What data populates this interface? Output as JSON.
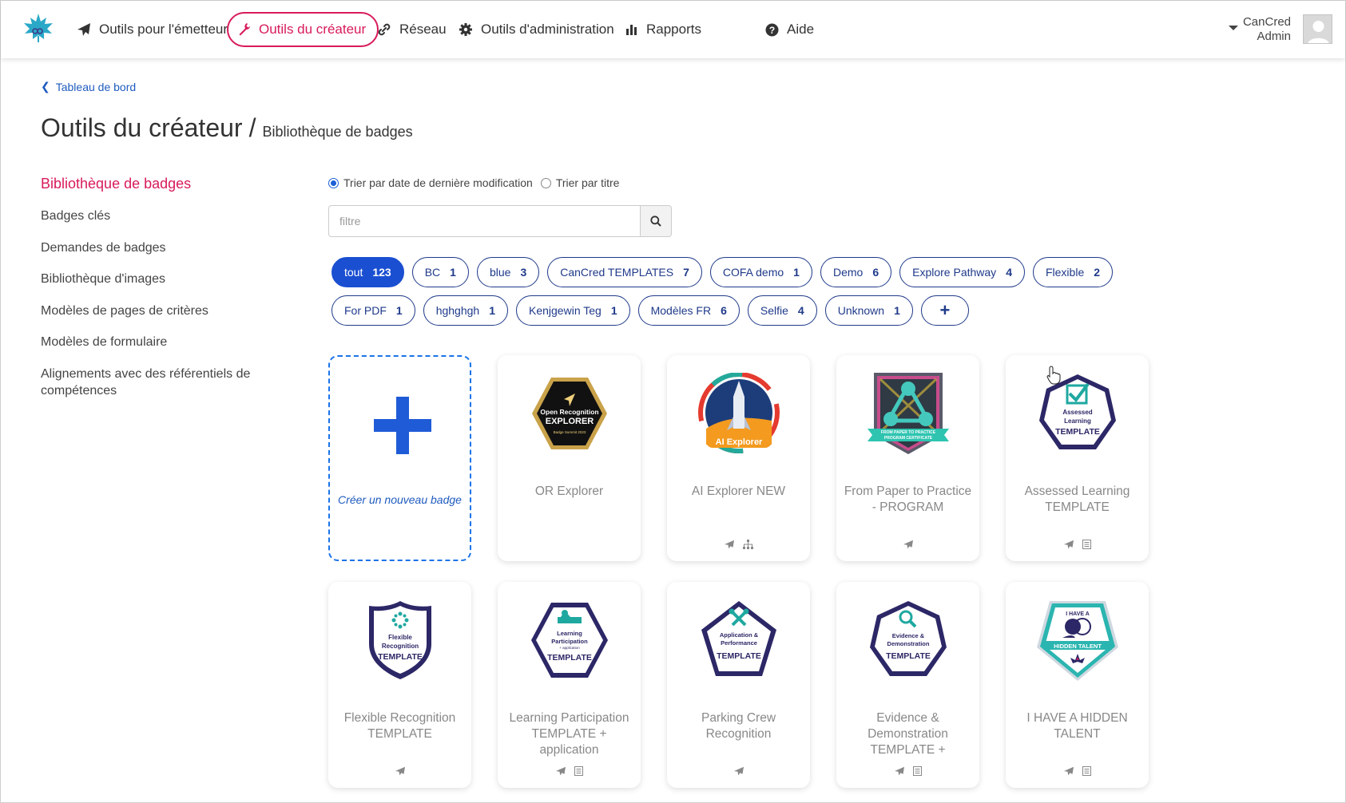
{
  "nav": {
    "items": [
      {
        "label": "Outils pour l'émetteur",
        "icon": "paper-plane-icon"
      },
      {
        "label": "Outils du créateur",
        "icon": "wrench-icon"
      },
      {
        "label": "Réseau",
        "icon": "link-icon"
      },
      {
        "label": "Outils d'administration",
        "icon": "gear-icon"
      },
      {
        "label": "Rapports",
        "icon": "bar-chart-icon"
      },
      {
        "label": "Aide",
        "icon": "question-circle-icon"
      }
    ],
    "user_line1": "CanCred",
    "user_line2": "Admin"
  },
  "breadcrumb": {
    "label": "Tableau de bord"
  },
  "page": {
    "title": "Outils du créateur",
    "separator": "/",
    "subtitle": "Bibliothèque de badges"
  },
  "sidebar": {
    "items": [
      {
        "label": "Bibliothèque de badges",
        "active": true
      },
      {
        "label": "Badges clés"
      },
      {
        "label": "Demandes de badges"
      },
      {
        "label": "Bibliothèque d'images"
      },
      {
        "label": "Modèles de pages de critères"
      },
      {
        "label": "Modèles de formulaire"
      },
      {
        "label": "Alignements avec des référentiels de compétences"
      }
    ]
  },
  "sort": {
    "by_date": "Trier par date de dernière modification",
    "by_title": "Trier par titre",
    "selected": "date"
  },
  "filter": {
    "placeholder": "filtre"
  },
  "tags": [
    {
      "label": "tout",
      "count": "123",
      "active": true
    },
    {
      "label": "BC",
      "count": "1"
    },
    {
      "label": "blue",
      "count": "3"
    },
    {
      "label": "CanCred TEMPLATES",
      "count": "7"
    },
    {
      "label": "COFA demo",
      "count": "1"
    },
    {
      "label": "Demo",
      "count": "6"
    },
    {
      "label": "Explore Pathway",
      "count": "4"
    },
    {
      "label": "Flexible",
      "count": "2"
    },
    {
      "label": "For PDF",
      "count": "1"
    },
    {
      "label": "hghghgh",
      "count": "1"
    },
    {
      "label": "Kenjgewin Teg",
      "count": "1"
    },
    {
      "label": "Modèles FR",
      "count": "6"
    },
    {
      "label": "Selfie",
      "count": "4"
    },
    {
      "label": "Unknown",
      "count": "1"
    },
    {
      "label": "+"
    }
  ],
  "create_badge": {
    "label": "Créer un nouveau badge"
  },
  "badges": [
    {
      "name": "OR Explorer",
      "art_lines": [
        "Open Recognition",
        "EXPLORER",
        "Badge Summit 2023"
      ],
      "icons": []
    },
    {
      "name": "AI Explorer NEW",
      "art_lines": [
        "AI Explorer"
      ],
      "icons": [
        "paper-plane-icon",
        "sitemap-icon"
      ]
    },
    {
      "name": "From Paper to Practice - PROGRAM",
      "art_lines": [
        "FROM PAPER TO PRACTICE",
        "PROGRAM CERTIFICATE"
      ],
      "icons": [
        "paper-plane-icon"
      ]
    },
    {
      "name": "Assessed Learning TEMPLATE",
      "art_lines": [
        "Assessed",
        "Learning",
        "TEMPLATE"
      ],
      "icons": [
        "paper-plane-icon",
        "list-icon"
      ]
    },
    {
      "name": "Flexible Recognition TEMPLATE",
      "art_lines": [
        "Flexible",
        "Recognition",
        "TEMPLATE"
      ],
      "icons": [
        "paper-plane-icon"
      ]
    },
    {
      "name": "Learning Participation TEMPLATE + application",
      "art_lines": [
        "Learning",
        "Participation",
        "+ application",
        "TEMPLATE"
      ],
      "icons": [
        "paper-plane-icon",
        "list-icon"
      ]
    },
    {
      "name": "Parking Crew Recognition",
      "art_lines": [
        "Application &",
        "Performance",
        "TEMPLATE"
      ],
      "icons": [
        "paper-plane-icon"
      ]
    },
    {
      "name": "Evidence & Demonstration TEMPLATE +",
      "art_lines": [
        "Evidence &",
        "Demonstration",
        "TEMPLATE"
      ],
      "icons": [
        "paper-plane-icon",
        "list-icon"
      ]
    },
    {
      "name": "I HAVE A HIDDEN TALENT",
      "art_lines": [
        "I HAVE A",
        "HIDDEN TALENT"
      ],
      "icons": [
        "paper-plane-icon",
        "list-icon"
      ]
    }
  ],
  "colors": {
    "accent": "#d81b5a",
    "primary": "#1a4fd1",
    "link": "#1f5bbf",
    "badge_navy": "#2c2766"
  }
}
